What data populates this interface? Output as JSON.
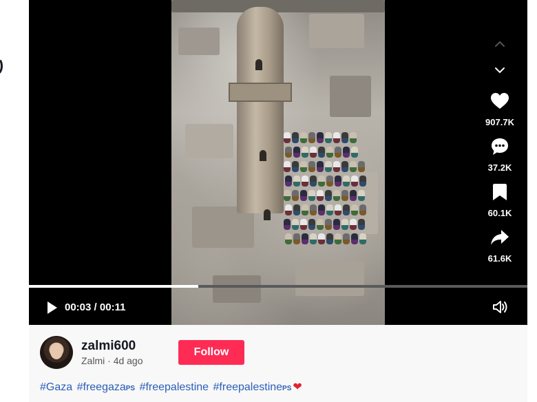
{
  "player": {
    "current_time": "00:03",
    "duration": "00:11",
    "progress_fraction": 0.34
  },
  "actions": {
    "likes": "907.7K",
    "comments": "37.2K",
    "saves": "60.1K",
    "shares": "61.6K"
  },
  "author": {
    "username": "zalmi600",
    "display_name": "Zalmi",
    "separator": " · ",
    "posted": "4d ago",
    "follow_label": "Follow"
  },
  "caption": {
    "tags": [
      {
        "text": "#Gaza",
        "suffix": ""
      },
      {
        "text": "#freegaza",
        "suffix": "PS"
      },
      {
        "text": "#freepalestine",
        "suffix": ""
      },
      {
        "text": "#freepalestine",
        "suffix": "PS"
      }
    ],
    "trailing_emoji": "❤"
  },
  "colors": {
    "accent": "#fe2c55",
    "hashtag": "#2b5db9",
    "video_bg": "#000000"
  },
  "icons": [
    "chevron-up-icon",
    "chevron-down-icon",
    "heart-icon",
    "comment-icon",
    "bookmark-icon",
    "share-icon",
    "play-icon",
    "volume-icon"
  ]
}
